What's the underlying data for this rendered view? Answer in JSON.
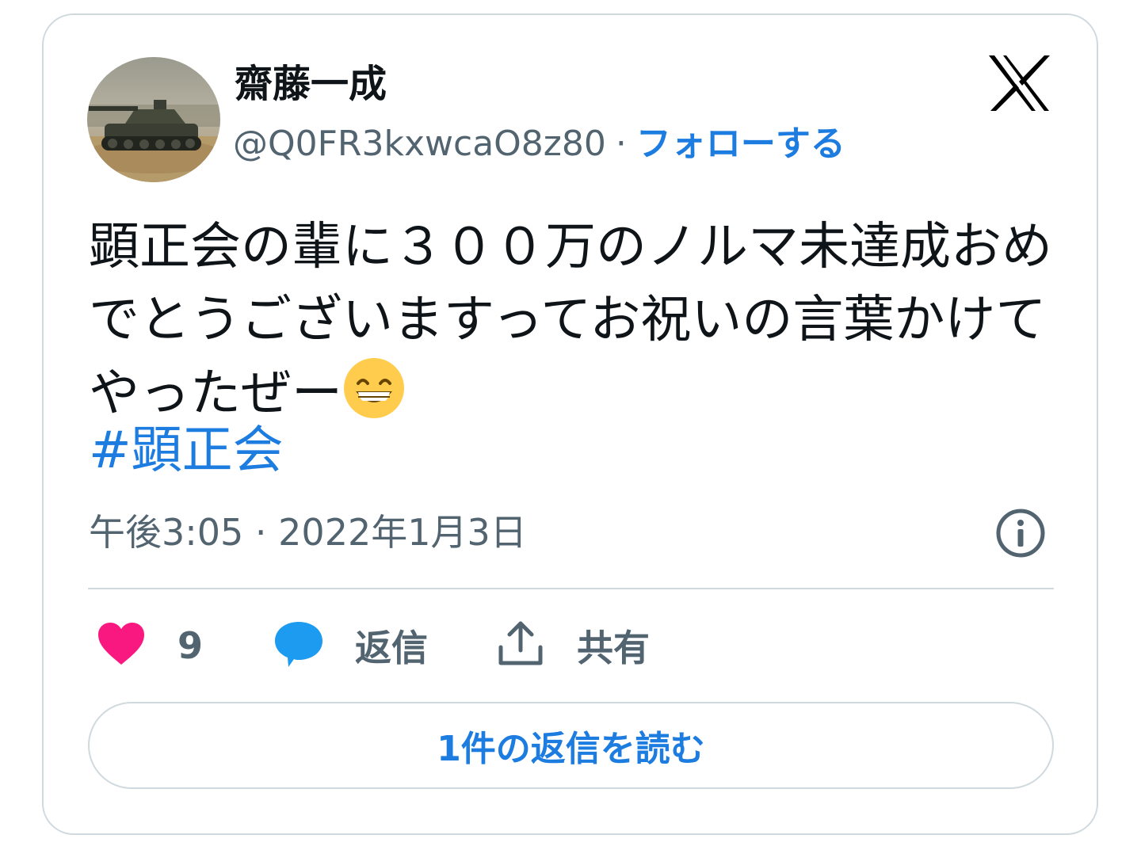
{
  "user": {
    "display_name": "齋藤一成",
    "handle": "@Q0FR3kxwcaO8z80",
    "separator": "·",
    "follow_label": "フォローする"
  },
  "tweet": {
    "text": "顕正会の輩に３００万のノルマ未達成おめでとうございますってお祝いの言葉かけてやったぜー",
    "emoji": "beaming-face-with-smiling-eyes",
    "hashtag": "#顕正会",
    "timestamp": "午後3:05 · 2022年1月3日"
  },
  "actions": {
    "like_count": "9",
    "reply_label": "返信",
    "share_label": "共有"
  },
  "footer": {
    "read_replies_label": "1件の返信を読む"
  },
  "icons": {
    "logo": "x-logo-icon",
    "info": "info-icon",
    "like": "heart-icon",
    "reply": "speech-bubble-icon",
    "share": "share-upload-icon"
  },
  "colors": {
    "link": "#1d7ce0",
    "like": "#f91880",
    "reply": "#1d9bf0",
    "muted": "#536471",
    "text": "#0f1419",
    "border": "#cfd9de"
  }
}
